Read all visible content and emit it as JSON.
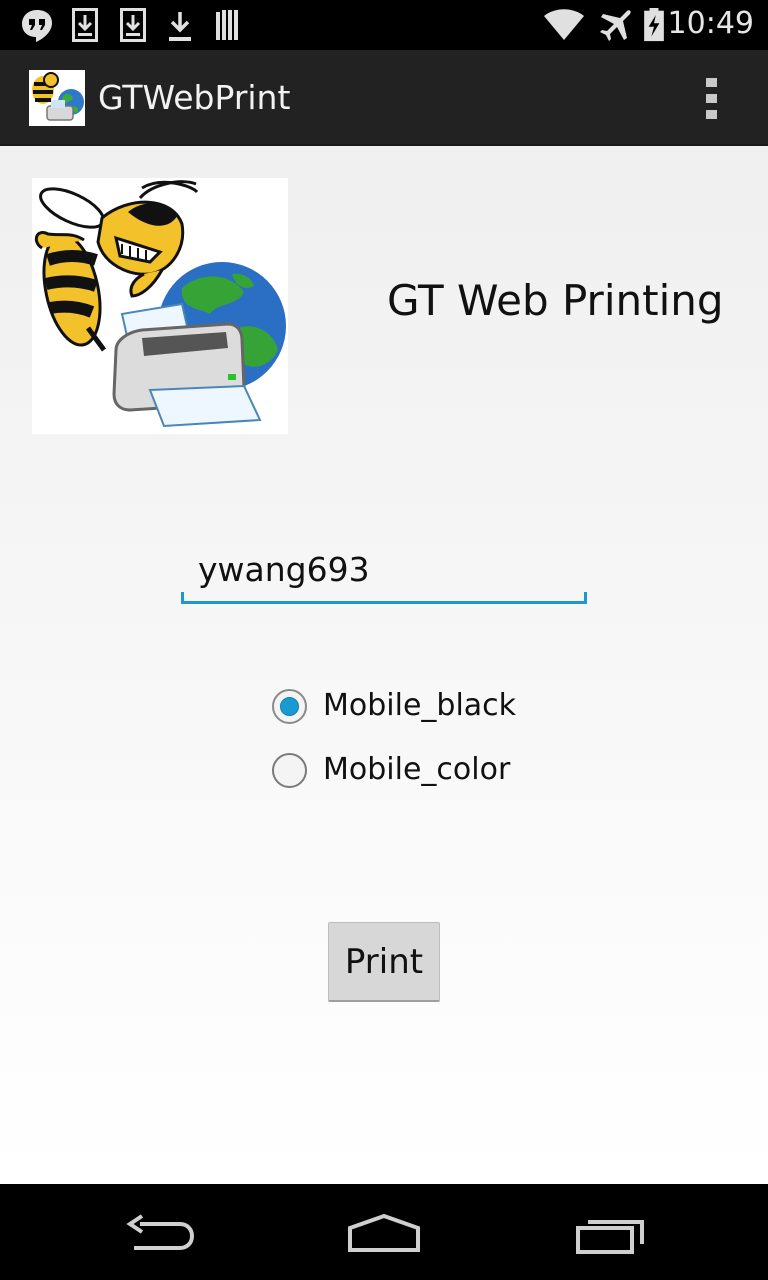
{
  "status_bar": {
    "time": "10:49",
    "left_icons": [
      "hangouts-icon",
      "download-icon",
      "download-icon",
      "download-icon",
      "library-icon"
    ],
    "right_icons": [
      "wifi-icon",
      "airplane-mode-icon",
      "battery-icon"
    ]
  },
  "action_bar": {
    "title": "GTWebPrint",
    "menu_icon": "overflow-menu-icon"
  },
  "main": {
    "heading": "GT Web Printing",
    "username_value": "ywang693",
    "radio_options": [
      {
        "label": "Mobile_black",
        "checked": true
      },
      {
        "label": "Mobile_color",
        "checked": false
      }
    ],
    "print_label": "Print"
  },
  "nav_bar": {
    "icons": [
      "back-icon",
      "home-icon",
      "recent-apps-icon"
    ]
  },
  "colors": {
    "accent": "#1d98cf",
    "status_bar": "#000000",
    "action_bar": "#222222"
  }
}
